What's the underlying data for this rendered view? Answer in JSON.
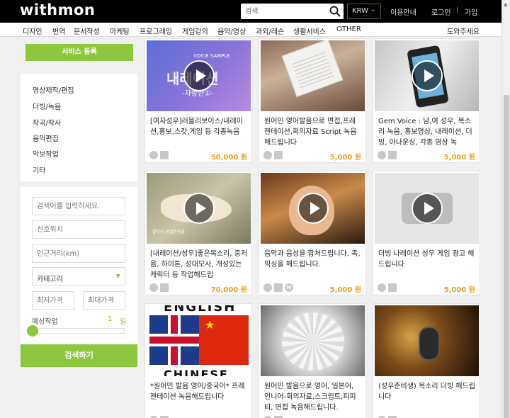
{
  "header": {
    "logo": "withmon",
    "search_placeholder": "검색",
    "currency": "KRW",
    "links": [
      "이용안내",
      "로그인",
      "가입"
    ]
  },
  "categories": [
    "디자인",
    "번역",
    "문서작성",
    "마케팅",
    "프로그래밍",
    "게임강의",
    "음악/영상",
    "과외/레슨",
    "생활서비스",
    "OTHER",
    "도와주세요"
  ],
  "sidebar": {
    "register_button": "서비스 등록",
    "items": [
      "영상제작/편집",
      "더빙/녹음",
      "작곡/작사",
      "음악편집",
      "악보작업",
      "기타"
    ],
    "filters": {
      "keyword_placeholder": "검색어를 입력하세요.",
      "location_placeholder": "선호위치",
      "distance_placeholder": "인근거리(km)",
      "category_select": "카테고리",
      "min_price_placeholder": "최저가격",
      "max_price_placeholder": "최대가격",
      "estimate_label": "예상작업",
      "estimate_value": "1",
      "estimate_unit": "일",
      "submit": "검색하기"
    }
  },
  "cards": [
    {
      "title": "[여자성우]러블리보이스/내레이션,홍보,스캇,게임 등 각종녹음",
      "price": "50,000 원",
      "thumb_text": [
        "VOICE SAMPLE",
        "내레이션",
        "-자랑한①-"
      ],
      "icons": [
        "phone",
        "mail"
      ]
    },
    {
      "title": "원어민 영어발음으로 면접,프레젠테이션,회의자료 Script 녹음해드립니다",
      "price": "5,000 원",
      "icons": [
        "phone",
        "mail"
      ]
    },
    {
      "title": "Gem Voice : 남,여 성우, 목소리 녹음, 홍보영상, 내레이션, 더빙, 아나운싱, 각종 영상 녹",
      "price": "5,000 원",
      "icons": [
        "phone",
        "mail"
      ]
    },
    {
      "title": "[내레이션/성우]좋은목소리, 중저음, 하이톤, 성대모사, 개성있는 캐릭터 등 작업해드립",
      "price": "70,000 원",
      "thumb_text": [
        "앞다리 관절운동을"
      ],
      "icons": [
        "phone",
        "mail"
      ]
    },
    {
      "title": "음악과 음성을 합처드립니다. 족, 믹싱을 해드립니다.",
      "price": "5,000 원",
      "icons": [
        "phone",
        "mail",
        "M"
      ]
    },
    {
      "title": "더빙 나레이션 성우 게임 광고 해드립니다",
      "price": "5,000 원",
      "icons": [
        "phone",
        "mail"
      ]
    },
    {
      "title": "*원어민 발음 영어/중국어* 프레젠테이션 녹음해드립니다",
      "price": "",
      "thumb_text": [
        "ENGLISH",
        "CHINESE"
      ],
      "icons": [
        "phone",
        "mail"
      ]
    },
    {
      "title": "원어민 발음으로 영어, 일본어, 인니어-회의자료,스크립트,피피티, 면접 녹음해드립니다.",
      "price": "",
      "icons": [
        "phone",
        "mail"
      ]
    },
    {
      "title": "(성우준비생) 목소리 더빙 해드립니다",
      "price": "",
      "icons": [
        "phone",
        "mail"
      ]
    }
  ]
}
